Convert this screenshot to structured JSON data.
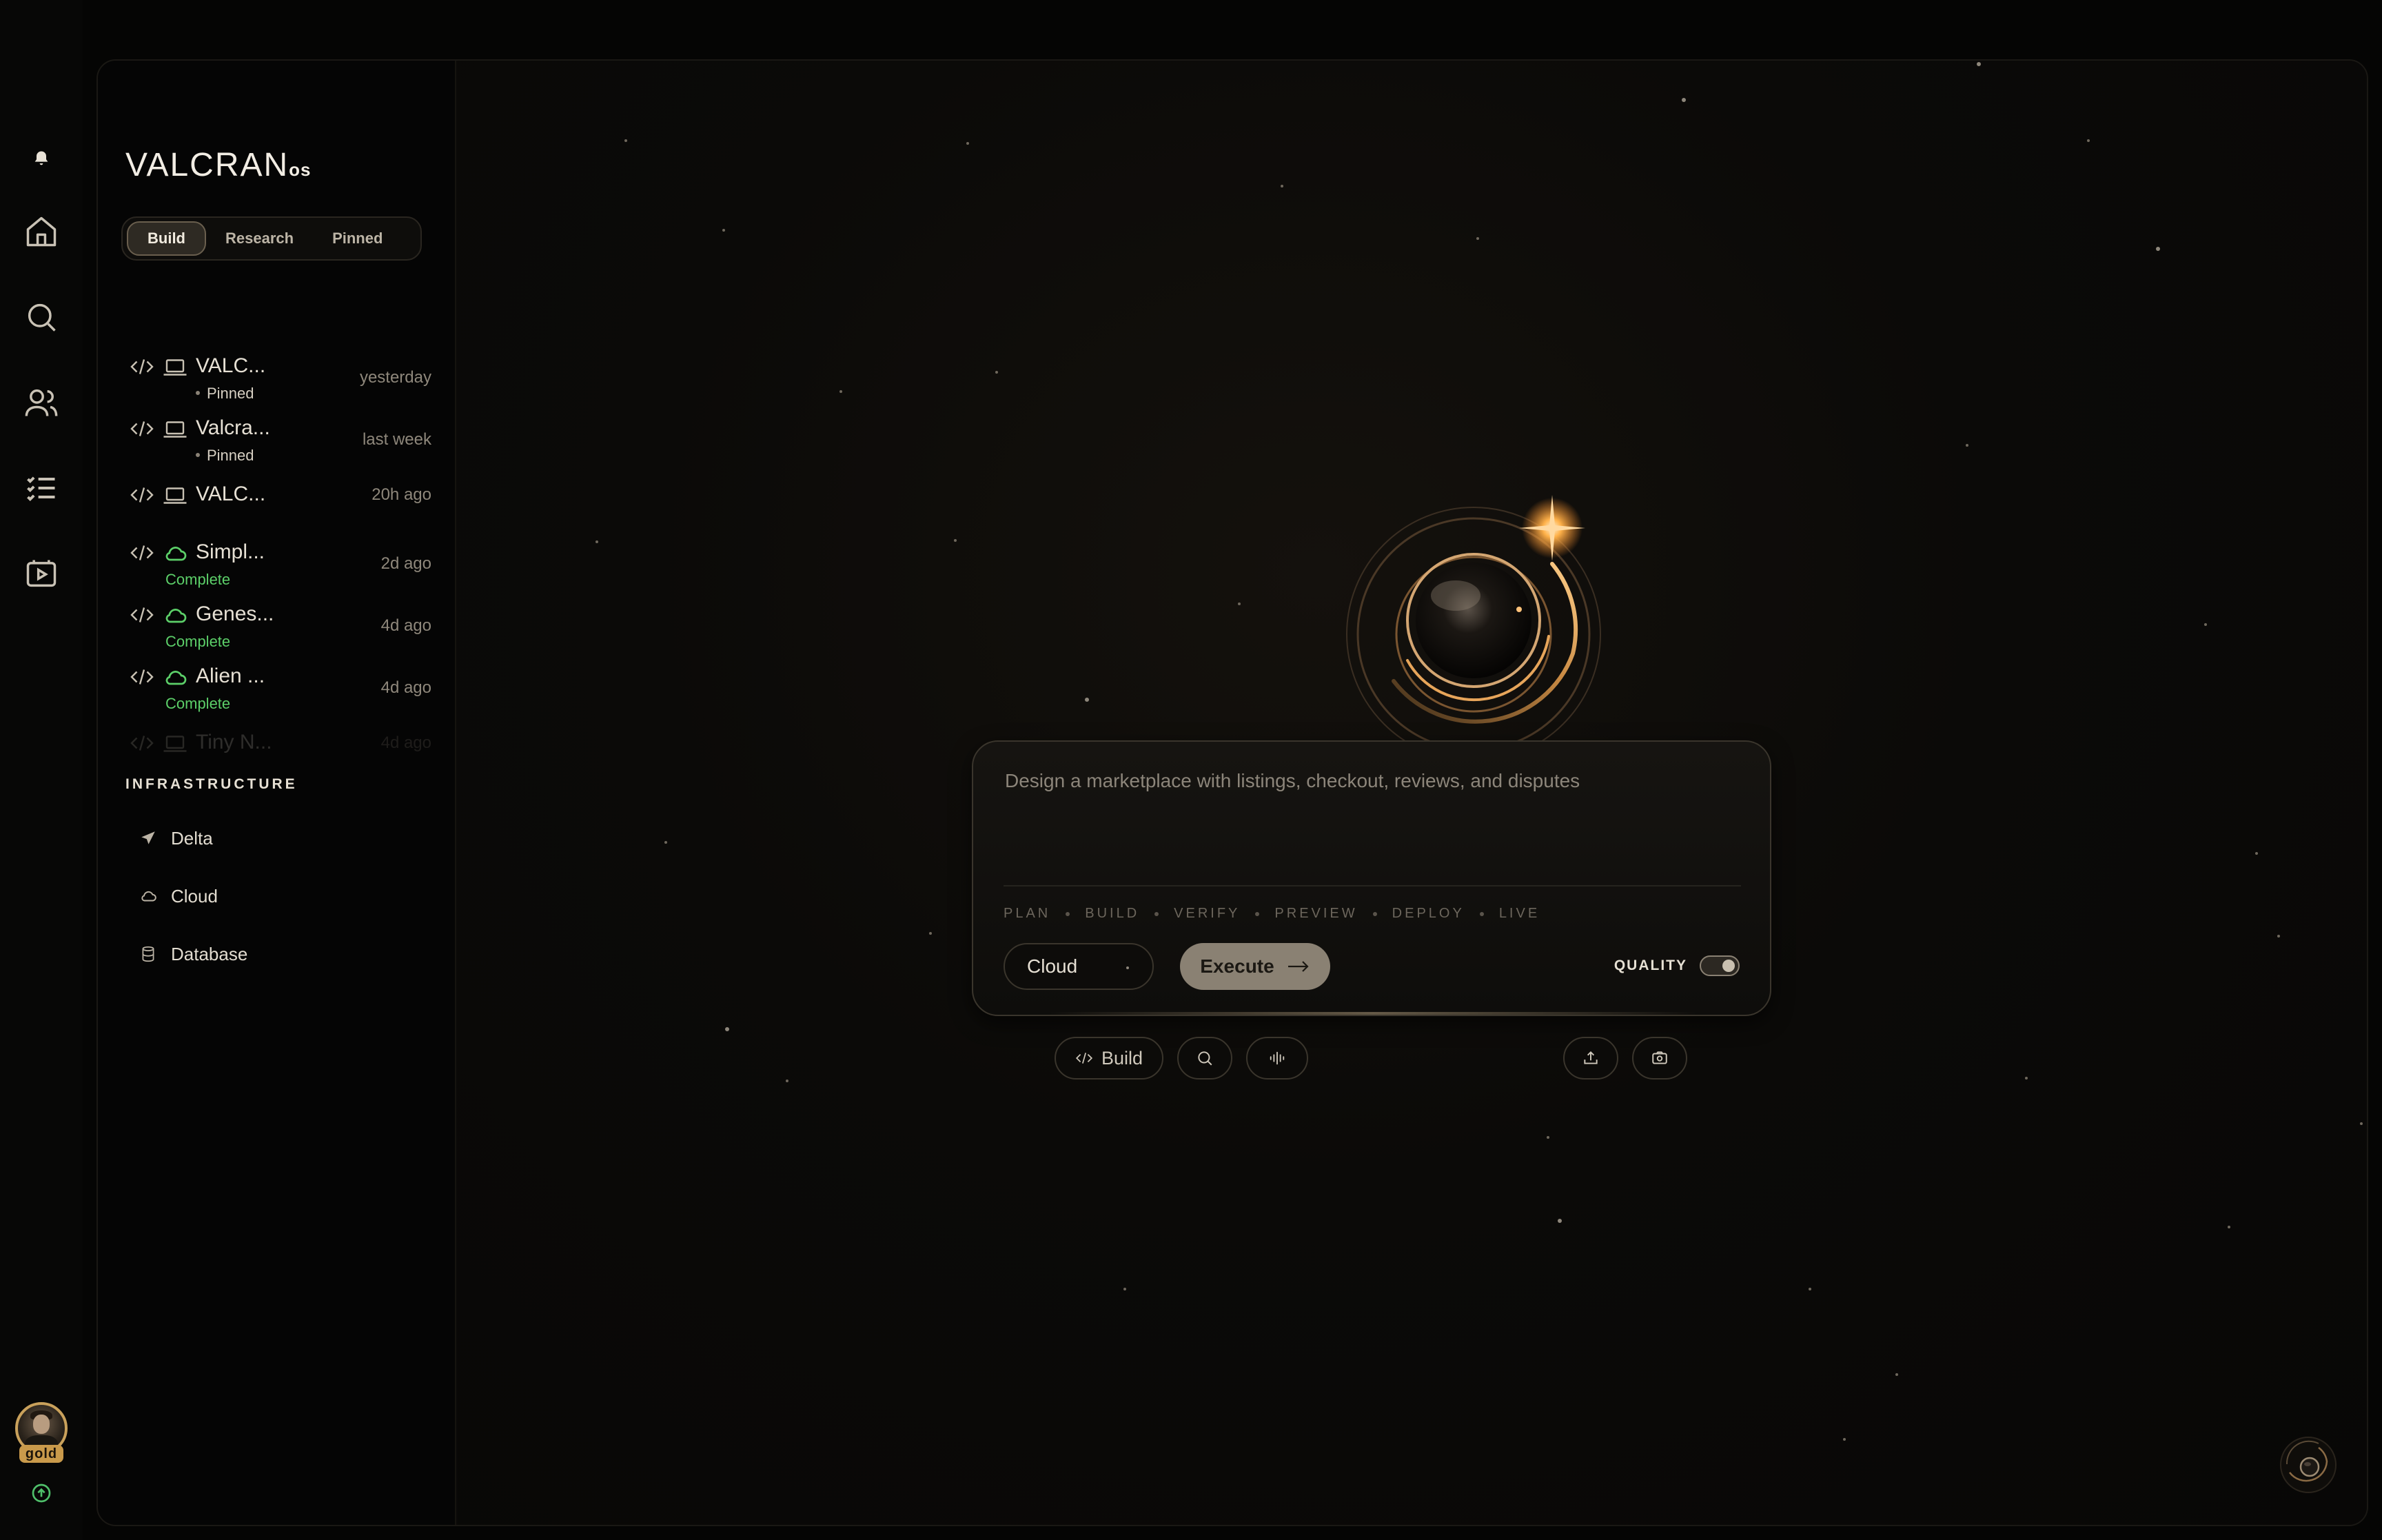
{
  "app": {
    "logo_text": "VALCRAN",
    "logo_suffix": "os"
  },
  "rail": {
    "items": [
      {
        "icon": "bell-icon"
      },
      {
        "icon": "home-icon"
      },
      {
        "icon": "search-icon"
      },
      {
        "icon": "users-icon"
      },
      {
        "icon": "task-list-icon"
      },
      {
        "icon": "video-icon"
      }
    ],
    "user_badge": "gold"
  },
  "sidebar": {
    "tabs": [
      {
        "label": "Build",
        "active": true
      },
      {
        "label": "Research",
        "active": false
      },
      {
        "label": "Pinned",
        "active": false
      }
    ],
    "items": [
      {
        "name": "VALC...",
        "type": "laptop-icon",
        "status": "Pinned",
        "status_kind": "pinned",
        "time": "yesterday"
      },
      {
        "name": "Valcra...",
        "type": "laptop-icon",
        "status": "Pinned",
        "status_kind": "pinned",
        "time": "last week"
      },
      {
        "name": "VALC...",
        "type": "laptop-icon",
        "status": "",
        "status_kind": "none",
        "time": "20h ago"
      },
      {
        "name": "Simpl...",
        "type": "cloud-icon",
        "status": "Complete",
        "status_kind": "complete",
        "time": "2d ago"
      },
      {
        "name": "Genes...",
        "type": "cloud-icon",
        "status": "Complete",
        "status_kind": "complete",
        "time": "4d ago"
      },
      {
        "name": "Alien ...",
        "type": "cloud-icon",
        "status": "Complete",
        "status_kind": "complete",
        "time": "4d ago"
      },
      {
        "name": "Tiny N...",
        "type": "laptop-icon",
        "status": "",
        "status_kind": "none",
        "time": "4d ago"
      }
    ],
    "infrastructure_title": "INFRASTRUCTURE",
    "infrastructure": [
      {
        "label": "Delta",
        "icon": "send-icon"
      },
      {
        "label": "Cloud",
        "icon": "cloud-icon"
      },
      {
        "label": "Database",
        "icon": "database-icon"
      }
    ]
  },
  "prompt": {
    "placeholder": "Design a marketplace with listings, checkout, reviews, and disputes",
    "stages": [
      "PLAN",
      "BUILD",
      "VERIFY",
      "PREVIEW",
      "DEPLOY",
      "LIVE"
    ],
    "target_select": "Cloud",
    "execute_label": "Execute",
    "quality_label": "QUALITY",
    "quality_on": true
  },
  "tools": {
    "build_label": "Build"
  },
  "colors": {
    "accent": "#c9a15b",
    "complete": "#5ccf69",
    "execute_bg": "#8a8173"
  }
}
